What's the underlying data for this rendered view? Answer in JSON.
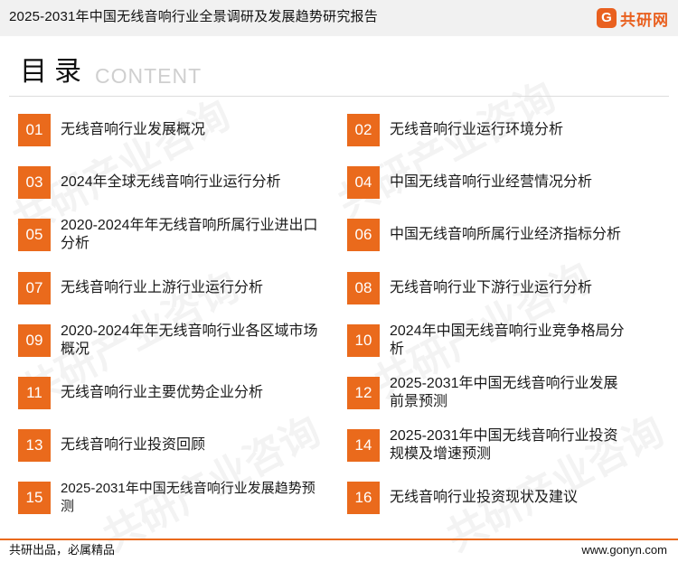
{
  "header": {
    "title": "2025-2031年中国无线音响行业全景调研及发展趋势研究报告",
    "logo_icon": "G",
    "logo_text": "共研网"
  },
  "heading": {
    "main": "目录",
    "sub": "CONTENT"
  },
  "watermark": {
    "text": "共研产业咨询"
  },
  "toc": [
    {
      "num": "01",
      "label": "无线音响行业发展概况"
    },
    {
      "num": "02",
      "label": "无线音响行业运行环境分析"
    },
    {
      "num": "03",
      "label": "2024年全球无线音响行业运行分析"
    },
    {
      "num": "04",
      "label": "中国无线音响行业经营情况分析"
    },
    {
      "num": "05",
      "label": "2020-2024年年无线音响所属行业进出口分析"
    },
    {
      "num": "06",
      "label": "中国无线音响所属行业经济指标分析"
    },
    {
      "num": "07",
      "label": "无线音响行业上游行业运行分析"
    },
    {
      "num": "08",
      "label": "无线音响行业下游行业运行分析"
    },
    {
      "num": "09",
      "label": "2020-2024年年无线音响行业各区域市场概况"
    },
    {
      "num": "10",
      "label": "2024年中国无线音响行业竞争格局分析"
    },
    {
      "num": "11",
      "label": "无线音响行业主要优势企业分析"
    },
    {
      "num": "12",
      "label": "2025-2031年中国无线音响行业发展前景预测"
    },
    {
      "num": "13",
      "label": "无线音响行业投资回顾"
    },
    {
      "num": "14",
      "label": "2025-2031年中国无线音响行业投资规模及增速预测"
    },
    {
      "num": "15",
      "label": "2025-2031年中国无线音响行业发展趋势预测"
    },
    {
      "num": "16",
      "label": "无线音响行业投资现状及建议"
    }
  ],
  "footer": {
    "slogan": "共研出品，必属精品",
    "url": "www.gonyn.com"
  },
  "colors": {
    "accent": "#ea6a1c",
    "header_bg": "#f1f1f1"
  }
}
